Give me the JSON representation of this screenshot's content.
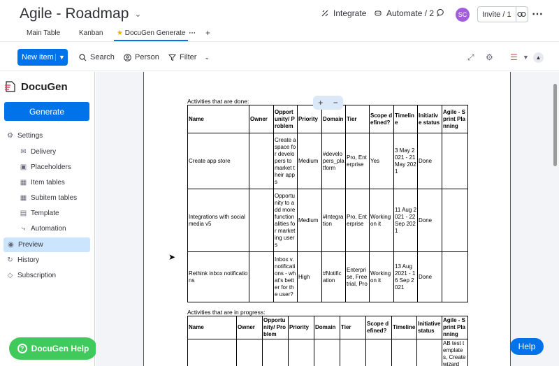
{
  "header": {
    "title": "Agile - Roadmap",
    "integrate": "Integrate",
    "automate": "Automate / 2",
    "avatar": "SC",
    "invite": "Invite / 1"
  },
  "tabs": [
    "Main Table",
    "Kanban",
    "DocuGen Generate"
  ],
  "toolbar": {
    "new_item": "New item",
    "search": "Search",
    "person": "Person",
    "filter": "Filter"
  },
  "sidebar": {
    "logo": "DocuGen",
    "generate": "Generate",
    "settings": "Settings",
    "items": [
      "Delivery",
      "Placeholders",
      "Item tables",
      "Subitem tables",
      "Template",
      "Automation"
    ],
    "preview": "Preview",
    "history": "History",
    "subscription": "Subscription",
    "help": "DocuGen Help"
  },
  "doc": {
    "caption_done": "Activities that are done:",
    "caption_progress": "Activities that are in progress:",
    "headers_done": [
      "Name",
      "Owner",
      "Opportunity/ Problem",
      "Priority",
      "Domain",
      "Tier",
      "Scope defined?",
      "Timeline",
      "Initiative status",
      "Agile - Sprint Planning"
    ],
    "rows_done": [
      [
        "Create app store",
        "",
        "Create a space for developers to market their apps",
        "Medium",
        "#developers_platform",
        "Pro, Enterprise",
        "Yes",
        "3 May 2021 - 21 May 2021",
        "Done",
        ""
      ],
      [
        "Integrations with social media  v5",
        "",
        "Opportunity to add more functionalities for marketing users",
        "Medium",
        "#Integration",
        "Pro, Enterprise",
        "Working on it",
        "11 Aug 2021 - 22 Sep 2021",
        "Done",
        ""
      ],
      [
        "Rethink inbox notifications",
        "",
        "Inbox v. notifications - what's better for the user?",
        "High",
        "#Notification",
        "Enterprise, Free trial, Pro",
        "Working on it",
        "13 Aug 2021 - 16 Sep 2021",
        "Done",
        ""
      ]
    ],
    "headers_progress": [
      "Name",
      "Owner",
      "Opportunity/ Problem",
      "Priority",
      "Domain",
      "Tier",
      "Scope defined?",
      "Timeline",
      "Initiative status",
      "Agile - Sprint Planning"
    ],
    "rows_progress": [
      [
        "",
        "",
        "",
        "",
        "",
        "",
        "",
        "",
        "",
        "AB test templates, Create wizard"
      ]
    ]
  },
  "zoom": {
    "plus": "+",
    "minus": "−"
  },
  "help_button": "Help"
}
